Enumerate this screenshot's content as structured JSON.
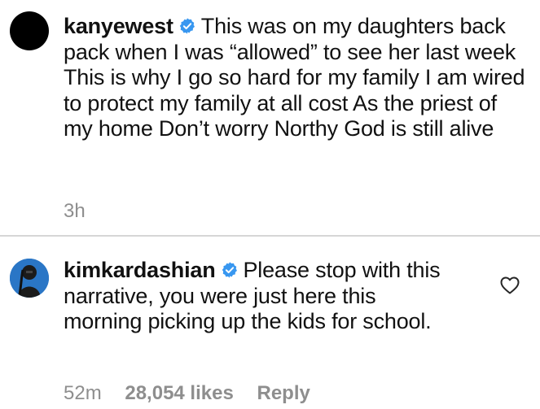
{
  "colors": {
    "verified_badge": "#3897f0",
    "meta_text": "#8e8e8e",
    "divider": "#d6d6d6"
  },
  "comments": [
    {
      "username": "kanyewest",
      "verified": true,
      "avatar_icon": "avatar-black-circle",
      "text": "This was on my daughters back pack when I was “allowed” to see her last week  This is why I go so hard for my family  I am wired to protect my family at all cost  As the priest of my home  Don’t worry Northy  God is still alive",
      "time": "3h"
    },
    {
      "username": "kimkardashian",
      "verified": true,
      "avatar_icon": "avatar-photo",
      "text": "Please stop with this narrative, you were just here this morning picking up the kids for school.",
      "time": "52m",
      "likes": "28,054 likes",
      "reply_label": "Reply",
      "like_icon": "heart-outline-icon"
    }
  ]
}
